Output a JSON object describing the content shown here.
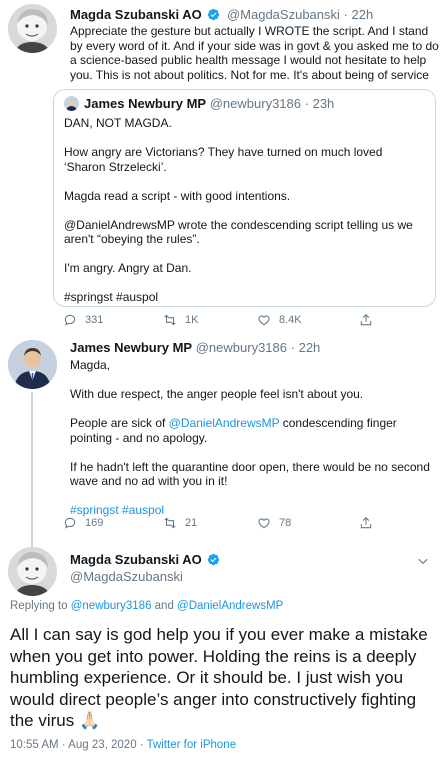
{
  "tweet1": {
    "name": "Magda Szubanski AO",
    "handle": "@MagdaSzubanski",
    "separator": "·",
    "time": "22h",
    "text": "Appreciate the gesture but actually I WROTE the script. And I stand by every word of it. And if your side was in govt & you asked me to do a science-based public health message I would not hesitate to help you. This is not about politics. Not for me. It's about being of service",
    "quote": {
      "name": "James Newbury MP",
      "handle": "@newbury3186",
      "separator": "·",
      "time": "23h",
      "p1": "DAN, NOT MAGDA.",
      "p2": "How angry are Victorians? They have turned on much loved ‘Sharon Strzelecki’.",
      "p3": "Magda read a script - with good intentions.",
      "p4": "@DanielAndrewsMP wrote the condescending script telling us we aren't “obeying the rules”.",
      "p5": "I'm angry. Angry at Dan.",
      "p6": "#springst #auspol"
    },
    "replies": "331",
    "retweets": "1K",
    "likes": "8.4K"
  },
  "tweet2": {
    "name": "James Newbury MP",
    "handle": "@newbury3186",
    "separator": "·",
    "time": "22h",
    "p1": "Magda,",
    "p2": "With due respect, the anger people feel isn't about you.",
    "p3_pre": "People are sick of ",
    "p3_link": "@DanielAndrewsMP",
    "p3_post": " condescending finger pointing - and no apology.",
    "p4": "If he hadn't left the quarantine door open, there would be no second wave and no ad with you in it!",
    "hashtags": "#springst #auspol",
    "replies": "169",
    "retweets": "21",
    "likes": "78"
  },
  "main": {
    "name": "Magda Szubanski AO",
    "handle": "@MagdaSzubanski",
    "replying_prefix": "Replying to ",
    "replying_user1": "@newbury3186",
    "replying_and": " and ",
    "replying_user2": "@DanielAndrewsMP",
    "text": "All I can say is god help you if you ever make a mistake when you get into power. Holding the reins is a deeply humbling experience. Or it should be. I just wish you would direct people’s anger into constructively fighting the virus 🙏🏻",
    "timestamp": "10:55 AM · Aug 23, 2020 · ",
    "client": "Twitter for iPhone"
  },
  "colors": {
    "accent": "#1b95e0",
    "verified": "#1da1f2",
    "muted": "#657786",
    "border": "#ccd6dd"
  },
  "icons": [
    "verified-badge-icon",
    "reply-icon",
    "retweet-icon",
    "like-icon",
    "share-icon",
    "chevron-down-icon"
  ]
}
